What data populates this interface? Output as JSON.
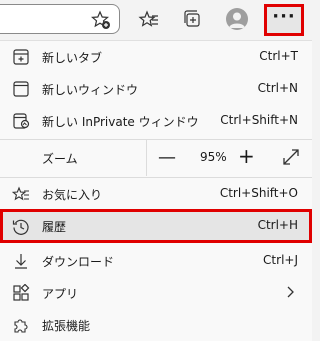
{
  "menu": {
    "new_tab": {
      "label": "新しいタブ",
      "shortcut": "Ctrl+T"
    },
    "new_window": {
      "label": "新しいウィンドウ",
      "shortcut": "Ctrl+N"
    },
    "new_inprivate": {
      "label": "新しい InPrivate ウィンドウ",
      "shortcut": "Ctrl+Shift+N"
    },
    "zoom": {
      "label": "ズーム",
      "minus": "—",
      "value": "95%",
      "plus": "+"
    },
    "favorites": {
      "label": "お気に入り",
      "shortcut": "Ctrl+Shift+O"
    },
    "history": {
      "label": "履歴",
      "shortcut": "Ctrl+H"
    },
    "downloads": {
      "label": "ダウンロード",
      "shortcut": "Ctrl+J"
    },
    "apps": {
      "label": "アプリ"
    },
    "extensions": {
      "label": "拡張機能"
    }
  },
  "toolbar": {
    "more_label": "···"
  },
  "colors": {
    "highlight_border": "#e00000"
  }
}
